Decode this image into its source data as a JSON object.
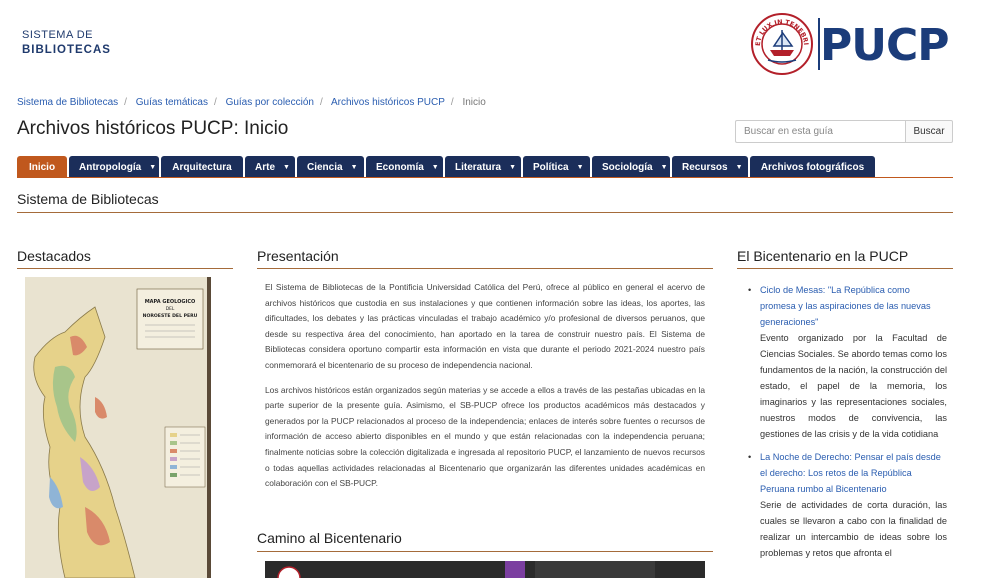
{
  "header": {
    "library_line1": "SISTEMA DE",
    "library_line2": "BIBLIOTECAS",
    "logo_text": "PUCP",
    "seal_text": "ET LUX IN TENEBRIS LUCET"
  },
  "breadcrumb": {
    "items": [
      "Sistema de Bibliotecas",
      "Guías temáticas",
      "Guías por colección",
      "Archivos históricos PUCP"
    ],
    "current": "Inicio"
  },
  "page_title": "Archivos históricos PUCP: Inicio",
  "search": {
    "placeholder": "Buscar en esta guía",
    "button": "Buscar"
  },
  "tabs": [
    {
      "label": "Inicio",
      "active": true,
      "dropdown": false
    },
    {
      "label": "Antropología",
      "dropdown": true
    },
    {
      "label": "Arquitectura",
      "dropdown": false
    },
    {
      "label": "Arte",
      "dropdown": true
    },
    {
      "label": "Ciencia",
      "dropdown": true
    },
    {
      "label": "Economía",
      "dropdown": true
    },
    {
      "label": "Literatura",
      "dropdown": true
    },
    {
      "label": "Política",
      "dropdown": true
    },
    {
      "label": "Sociología",
      "dropdown": true
    },
    {
      "label": "Recursos",
      "dropdown": true
    },
    {
      "label": "Archivos fotográficos",
      "dropdown": false
    }
  ],
  "section_title": "Sistema de Bibliotecas",
  "destacados": {
    "title": "Destacados",
    "map_title_lines": [
      "MAPA GEOLOGICO",
      "DEL",
      "NOROESTE DEL PERU"
    ]
  },
  "presentacion": {
    "title": "Presentación",
    "p1": "El Sistema de Bibliotecas de la Pontificia Universidad Católica del Perú, ofrece al público en general el acervo de archivos históricos que custodia en sus instalaciones y que contienen información sobre las ideas, los aportes, las dificultades, los debates y las prácticas vinculadas el trabajo académico y/o profesional de diversos peruanos, que desde su respectiva área del conocimiento, han aportado en la tarea de construir nuestro país. El Sistema de Bibliotecas considera oportuno compartir esta información en vista que durante el periodo 2021-2024 nuestro país conmemorará el bicentenario de su proceso de independencia nacional.",
    "p2": "Los archivos históricos están organizados según materias y se accede a ellos a través de las pestañas ubicadas en la parte superior de la presente guía. Asimismo, el SB-PUCP ofrece los productos académicos más destacados y generados por la PUCP relacionados al proceso de la independencia; enlaces de interés sobre fuentes o recursos de información de acceso abierto disponibles en el mundo y que están relacionadas con la independencia peruana; finalmente noticias sobre la colección digitalizada e ingresada al repositorio PUCP, el lanzamiento de nuevos recursos o todas aquellas actividades relacionadas al Bicentenario que organizarán las diferentes unidades académicas en colaboración con el SB-PUCP."
  },
  "camino": {
    "title": "Camino al Bicentenario"
  },
  "bicentenario": {
    "title": "El Bicentenario en la PUCP",
    "items": [
      {
        "link": "Ciclo de Mesas: \"La República como promesa y las aspiraciones de las nuevas generaciones\"",
        "desc": "Evento organizado por la Facultad de Ciencias Sociales. Se abordo temas como los fundamentos de la nación, la construcción del estado, el papel de la memoria, los imaginarios y las representaciones sociales, nuestros modos de convivencia, las gestiones de las crisis y de la vida cotidiana"
      },
      {
        "link": "La Noche de Derecho: Pensar el país desde el derecho: Los retos de la República Peruana rumbo al Bicentenario",
        "desc": "Serie de actividades de corta duración, las cuales se llevaron a cabo con la finalidad de realizar un intercambio de ideas sobre los problemas y retos que afronta el"
      }
    ]
  },
  "colors": {
    "tab_bg": "#1b2e5a",
    "tab_active": "#c0581d",
    "brand_blue": "#1b3c7a",
    "seal_red": "#b3202a",
    "link": "#2a5db0"
  }
}
